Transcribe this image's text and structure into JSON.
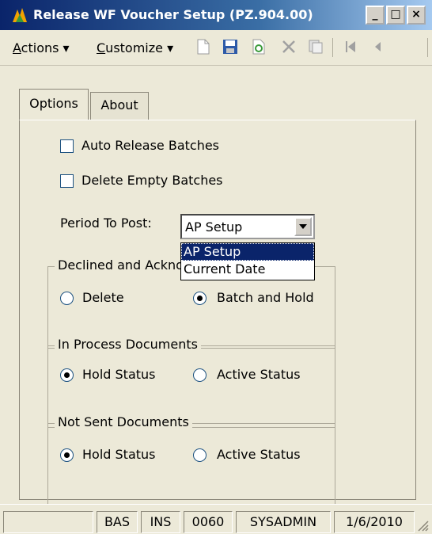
{
  "window": {
    "title": "Release WF Voucher Setup (PZ.904.00)",
    "minimize": "_",
    "maximize": "□",
    "close": "×"
  },
  "toolbar": {
    "actions_menu": "Actions",
    "customize_menu": "Customize",
    "menu_arrow": "▾",
    "icons": [
      "new-icon",
      "save-icon",
      "refresh-icon",
      "delete-icon",
      "copy-icon",
      "first-icon",
      "previous-icon"
    ]
  },
  "tabs": [
    {
      "label": "Options",
      "active": true
    },
    {
      "label": "About",
      "active": false
    }
  ],
  "options": {
    "auto_release_label": "Auto Release Batches",
    "auto_release_checked": false,
    "delete_empty_label": "Delete Empty Batches",
    "delete_empty_checked": false,
    "period_label": "Period To Post:",
    "period_value": "AP Setup",
    "period_options": [
      "AP Setup",
      "Current Date"
    ]
  },
  "groups": {
    "declined": {
      "legend": "Declined and Acknowledged",
      "option1": "Delete",
      "option2": "Batch and Hold",
      "selected": 2
    },
    "in_process": {
      "legend": "In Process Documents",
      "option1": "Hold Status",
      "option2": "Active Status",
      "selected": 1
    },
    "not_sent": {
      "legend": "Not Sent Documents",
      "option1": "Hold Status",
      "option2": "Active Status",
      "selected": 1
    }
  },
  "status": {
    "cells": [
      "",
      "BAS",
      "INS",
      "0060",
      "SYSADMIN",
      "1/6/2010"
    ]
  },
  "colors": {
    "titlebar": "#0a246a",
    "selection": "#0a246a",
    "background": "#ece9d8"
  }
}
